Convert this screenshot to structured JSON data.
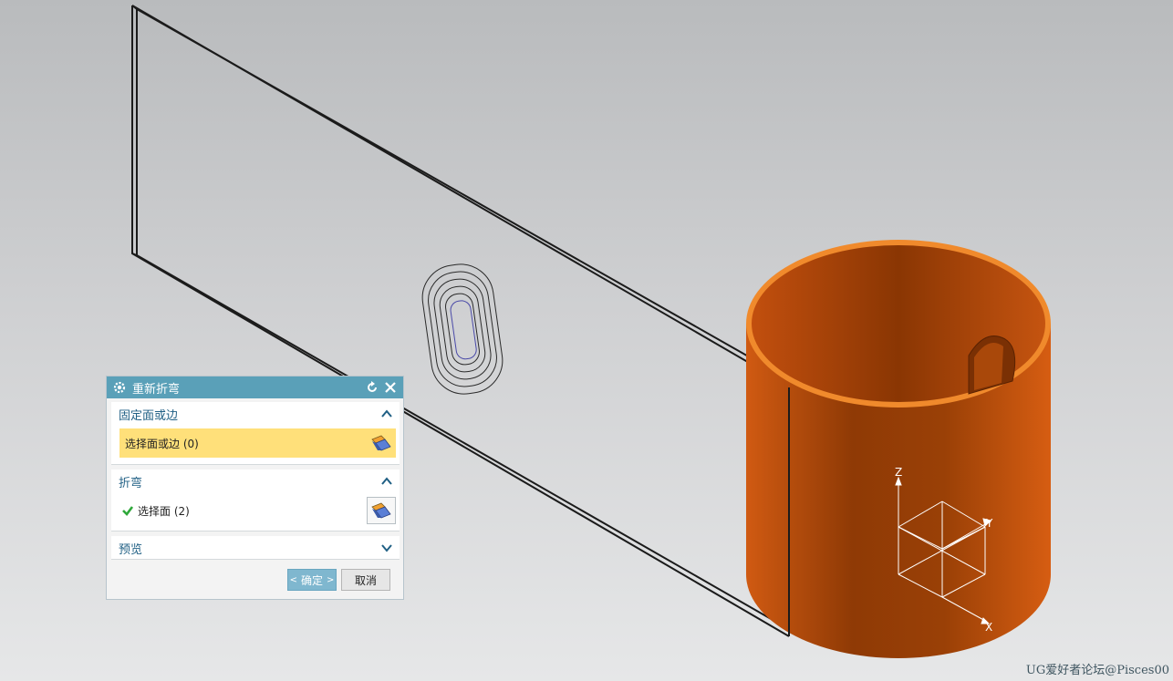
{
  "dialog": {
    "title": "重新折弯",
    "groups": [
      {
        "label": "固定面或边",
        "row_label": "选择面或边 (0)"
      },
      {
        "label": "折弯",
        "row_label": "选择面 (2)"
      },
      {
        "label": "预览"
      }
    ],
    "ok_left": "<",
    "ok_label": "确定",
    "ok_right": ">",
    "cancel_label": "取消"
  },
  "axes": {
    "z": "Z",
    "y": "Y",
    "x": "X"
  },
  "watermark": "UG爱好者论坛@Pisces00",
  "colors": {
    "dialog_title_bar": "#5aa0b8",
    "group_label": "#1f5f84",
    "active_row": "#ffe07a",
    "part_body": "#c75410",
    "part_rim": "#f07a1e"
  },
  "icons": [
    "settings-icon",
    "reset-icon",
    "close-icon",
    "chevron-up-icon",
    "chevron-down-icon",
    "face-select-icon",
    "checkmark-icon"
  ]
}
